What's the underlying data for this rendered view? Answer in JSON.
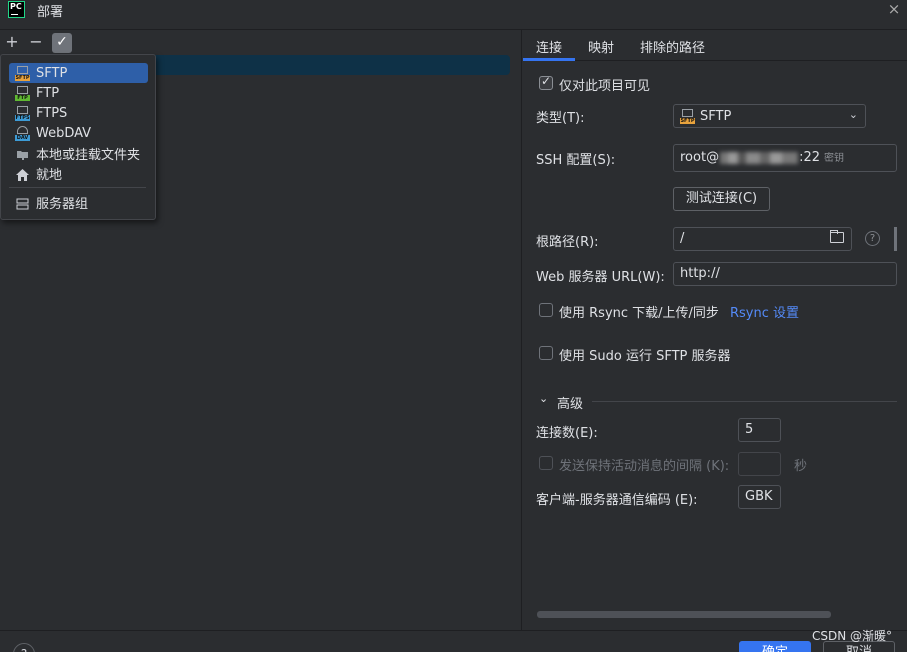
{
  "window": {
    "title": "部署",
    "close": "×",
    "logo": "PC"
  },
  "toolbar": {
    "add": "+",
    "remove": "−",
    "check": "✓"
  },
  "add_menu": {
    "items": [
      {
        "label": "SFTP",
        "icon": "sftp-icon"
      },
      {
        "label": "FTP",
        "icon": "ftp-icon"
      },
      {
        "label": "FTPS",
        "icon": "ftps-icon"
      },
      {
        "label": "WebDAV",
        "icon": "webdav-icon"
      },
      {
        "label": "本地或挂载文件夹",
        "icon": "folder-icon"
      },
      {
        "label": "就地",
        "icon": "home-icon"
      }
    ],
    "group": {
      "label": "服务器组",
      "icon": "server-group-icon"
    }
  },
  "tabs": [
    "连接",
    "映射",
    "排除的路径"
  ],
  "connection": {
    "visible_only_project": "仅对此项目可见",
    "type_label": "类型(T):",
    "type_value": "SFTP",
    "ssh_label": "SSH 配置(S):",
    "ssh_value_prefix": "root@",
    "ssh_value_suffix": ":22",
    "ssh_hint": "密钥",
    "test_button": "测试连接(C)",
    "root_label": "根路径(R):",
    "root_value": "/",
    "web_url_label": "Web 服务器 URL(W):",
    "web_url_value": "http://",
    "rsync_label": "使用 Rsync 下载/上传/同步",
    "rsync_link": "Rsync 设置",
    "sudo_label": "使用 Sudo 运行 SFTP 服务器",
    "advanced_label": "高级",
    "connections_label": "连接数(E):",
    "connections_value": "5",
    "keepalive_label": "发送保持活动消息的间隔 (K):",
    "keepalive_unit": "秒",
    "encoding_label": "客户端-服务器通信编码 (E):",
    "encoding_value": "GBK"
  },
  "footer": {
    "help": "?",
    "ok": "确定",
    "cancel": "取消",
    "watermark": "CSDN @渐暖°"
  }
}
